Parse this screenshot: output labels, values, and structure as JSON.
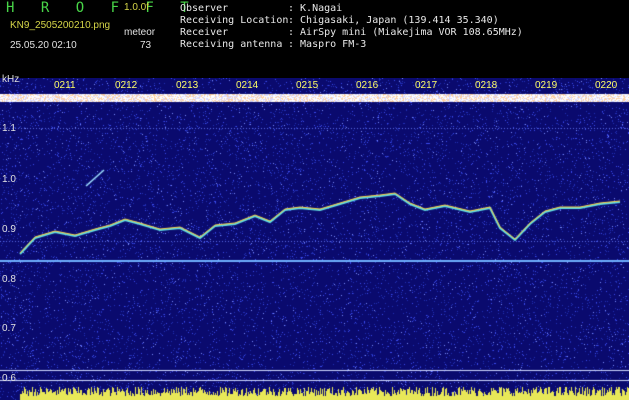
{
  "app": {
    "title": "H R O F F T",
    "version": "1.0.0f",
    "filename": "KN9_2505200210.png",
    "datetime": "25.05.20 02:10",
    "meteor_label": "meteor",
    "meteor_count": "73"
  },
  "info": [
    {
      "key": "Observer",
      "value": ": K.Nagai"
    },
    {
      "key": "Receiving Location",
      "value": ": Chigasaki, Japan (139.414 35.340)"
    },
    {
      "key": "Receiver",
      "value": ": AirSpy mini (Miakejima VOR 108.65MHz)"
    },
    {
      "key": "Receiving antenna",
      "value": ": Maspro FM-3"
    }
  ],
  "axis": {
    "y_unit": "kHz",
    "y_ticks": [
      "1.1",
      "1.0",
      "0.9",
      "0.8",
      "0.7",
      "0.6"
    ],
    "time_ticks": [
      "0211",
      "0212",
      "0213",
      "0214",
      "0215",
      "0216",
      "0217",
      "0218",
      "0219",
      "0220"
    ]
  },
  "colors": {
    "background": "#0a0a6e",
    "noise": "#3c4cf0",
    "trace": "#5ee0e8",
    "time_label": "#ffff66",
    "title": "#48d648"
  }
}
